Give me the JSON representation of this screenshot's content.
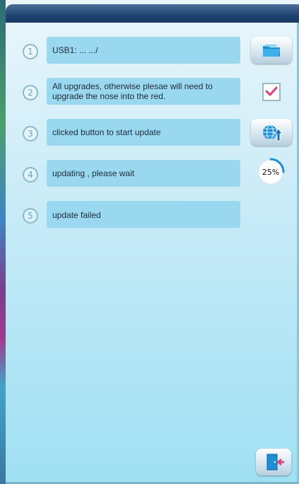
{
  "steps": [
    {
      "num": "1",
      "text": "USB1:  ...  .../"
    },
    {
      "num": "2",
      "text": "All upgrades, otherwise plesae will need to upgrade the nose into the red."
    },
    {
      "num": "3",
      "text": "clicked button to start update"
    },
    {
      "num": "4",
      "text": "updating , please wait"
    },
    {
      "num": "5",
      "text": "update failed"
    }
  ],
  "controls": {
    "folder_icon": "folder-icon",
    "checkbox_checked": true,
    "update_icon": "globe-upload-icon",
    "exit_icon": "exit-door-icon"
  },
  "progress": {
    "label": "25%",
    "value": 0.25,
    "color": "#1e8fd6"
  },
  "colors": {
    "accent": "#1e8fd6",
    "step_box": "#9ad8f0",
    "title_bar": "#1f4470",
    "check": "#e0407a"
  }
}
